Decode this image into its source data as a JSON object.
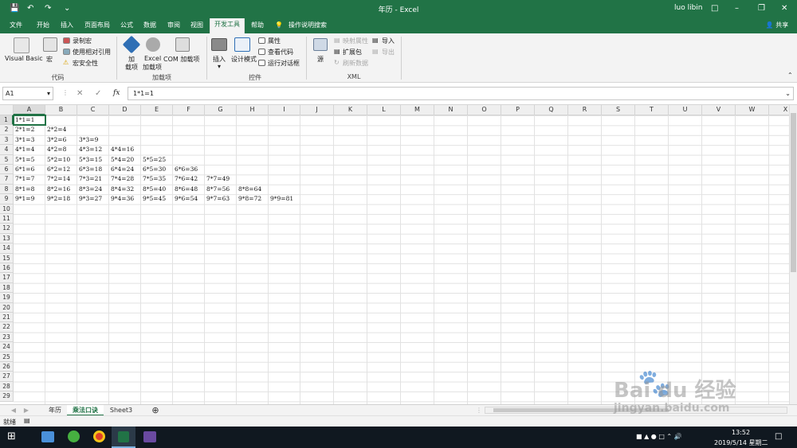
{
  "window": {
    "title": "年历 - Excel",
    "user": "luo libin",
    "share": "共享"
  },
  "tabs": [
    "文件",
    "开始",
    "插入",
    "页面布局",
    "公式",
    "数据",
    "审阅",
    "视图",
    "开发工具",
    "帮助"
  ],
  "active_tab": "开发工具",
  "search_hint": "操作说明搜索",
  "ribbon": {
    "code": {
      "vb": "Visual Basic",
      "macro": "宏",
      "record": "录制宏",
      "relative": "使用相对引用",
      "security": "宏安全性",
      "label": "代码"
    },
    "addins": {
      "add": "加\n载项",
      "add_a": "加",
      "add_b": "载项",
      "excel_a": "Excel",
      "excel_b": "加载项",
      "com": "COM 加载项",
      "label": "加载项"
    },
    "controls": {
      "insert": "插入",
      "design": "设计模式",
      "props": "属性",
      "view_code": "查看代码",
      "dialog": "运行对话框",
      "label": "控件"
    },
    "xml": {
      "source": "源",
      "map": "映射属性",
      "expand": "扩展包",
      "refresh": "刷新数据",
      "import": "导入",
      "export": "导出",
      "label": "XML"
    }
  },
  "formula_bar": {
    "name_box": "A1",
    "fx": "fx",
    "value": "1*1=1"
  },
  "columns": [
    "A",
    "B",
    "C",
    "D",
    "E",
    "F",
    "G",
    "H",
    "I",
    "J",
    "K",
    "L",
    "M",
    "N",
    "O",
    "P",
    "Q",
    "R",
    "S",
    "T",
    "U",
    "V",
    "W",
    "X"
  ],
  "rows": [
    "1",
    "2",
    "3",
    "4",
    "5",
    "6",
    "7",
    "8",
    "9",
    "10",
    "11",
    "12",
    "13",
    "14",
    "15",
    "16",
    "17",
    "18",
    "19",
    "20",
    "21",
    "22",
    "23",
    "24",
    "25",
    "26",
    "27",
    "28",
    "29"
  ],
  "cells": [
    [
      "1*1=1"
    ],
    [
      "2*1=2",
      "2*2=4"
    ],
    [
      "3*1=3",
      "3*2=6",
      "3*3=9"
    ],
    [
      "4*1=4",
      "4*2=8",
      "4*3=12",
      "4*4=16"
    ],
    [
      "5*1=5",
      "5*2=10",
      "5*3=15",
      "5*4=20",
      "5*5=25"
    ],
    [
      "6*1=6",
      "6*2=12",
      "6*3=18",
      "6*4=24",
      "6*5=30",
      "6*6=36"
    ],
    [
      "7*1=7",
      "7*2=14",
      "7*3=21",
      "7*4=28",
      "7*5=35",
      "7*6=42",
      "7*7=49"
    ],
    [
      "8*1=8",
      "8*2=16",
      "8*3=24",
      "8*4=32",
      "8*5=40",
      "8*6=48",
      "8*7=56",
      "8*8=64"
    ],
    [
      "9*1=9",
      "9*2=18",
      "9*3=27",
      "9*4=36",
      "9*5=45",
      "9*6=54",
      "9*7=63",
      "9*8=72",
      "9*9=81"
    ]
  ],
  "sheets": [
    "年历",
    "乘法口诀",
    "Sheet3"
  ],
  "active_sheet": "乘法口诀",
  "status": {
    "ready": "就绪"
  },
  "taskbar": {
    "time": "13:52",
    "date": "2019/5/14 星期二"
  },
  "watermark": {
    "main": "Bai du 经验",
    "sub": "jingyan.baidu.com"
  },
  "colors": {
    "excel_green": "#217346",
    "taskbar": "#101820"
  }
}
